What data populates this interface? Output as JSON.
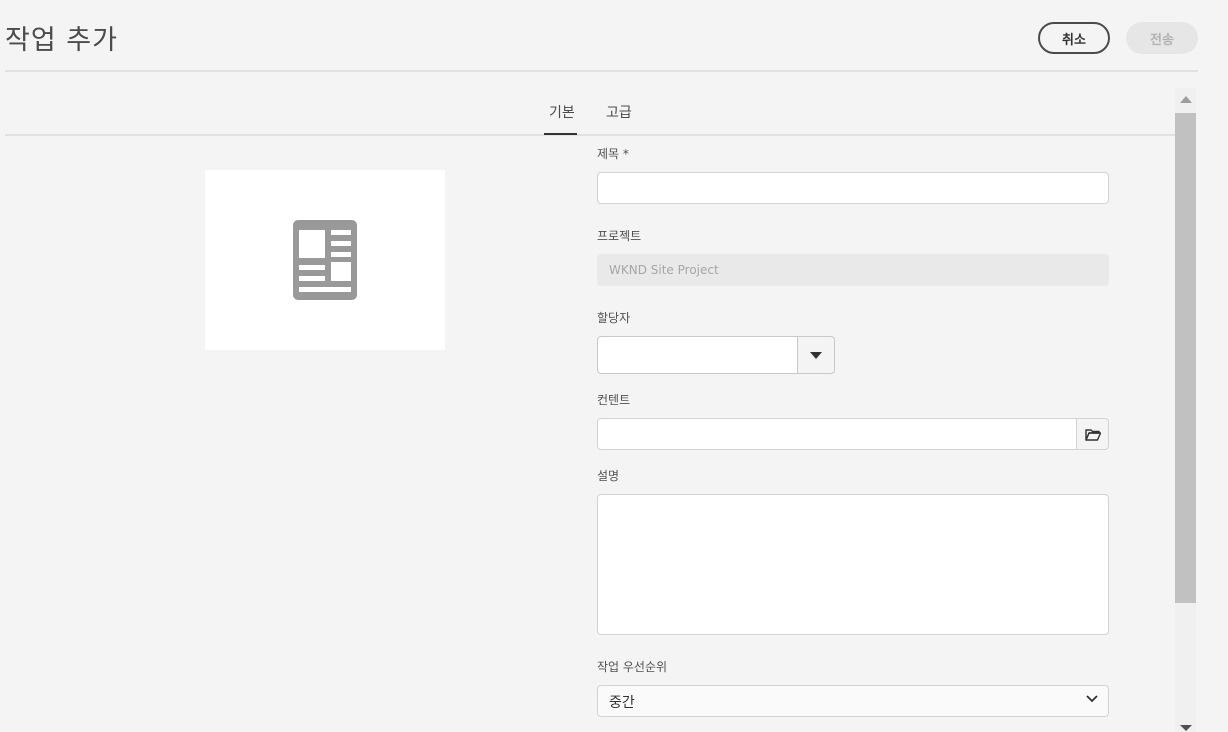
{
  "header": {
    "title": "작업 추가",
    "cancel_label": "취소",
    "submit_label": "전송"
  },
  "tabs": [
    {
      "label": "기본",
      "active": true
    },
    {
      "label": "고급",
      "active": false
    }
  ],
  "thumbnail": {
    "icon": "document-layout-icon"
  },
  "form": {
    "title_label": "제목 *",
    "title_value": "",
    "project_label": "프로젝트",
    "project_value": "WKND Site Project",
    "assignee_label": "할당자",
    "assignee_value": "",
    "content_label": "컨텐트",
    "content_value": "",
    "description_label": "설명",
    "description_value": "",
    "priority_label": "작업 우선순위",
    "priority_value": "중간"
  },
  "colors": {
    "background": "#f4f4f4",
    "text": "#4b4b4b",
    "icon_gray": "#999999",
    "disabled_button": "#e6e6e6"
  }
}
